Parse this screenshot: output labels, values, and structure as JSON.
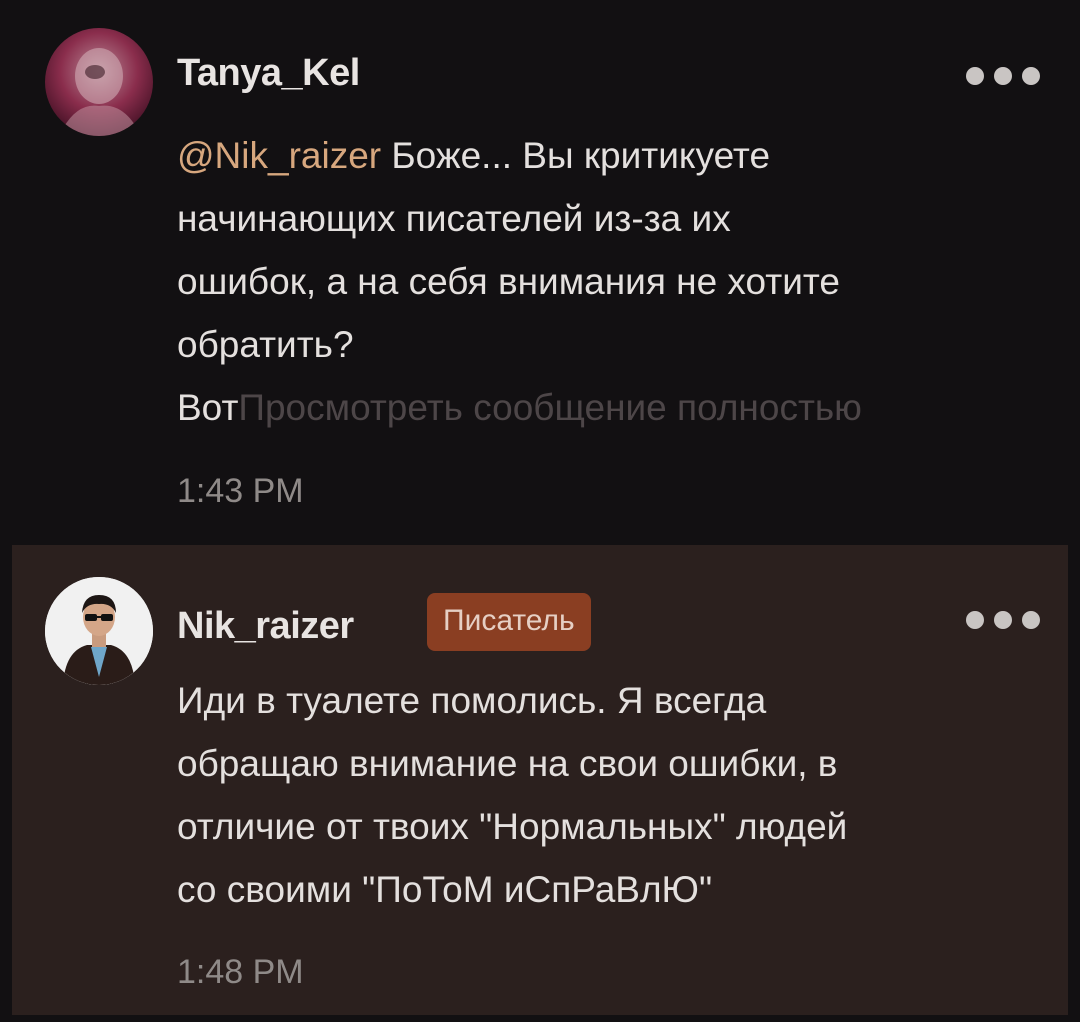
{
  "comments": [
    {
      "username": "Tanya_Kel",
      "avatar_icon": "user-avatar-photo-icon",
      "more_icon": "more-options-icon",
      "mention": "@Nik_raizer",
      "lines": [
        " Боже... Вы критикуете",
        "начинающих писателей из-за их",
        "ошибок, а на себя внимания не хотите",
        "обратить?"
      ],
      "last_line_visible": "Вот",
      "expand_link": "Просмотреть сообщение полностью",
      "time": "1:43 PM"
    },
    {
      "username": "Nik_raizer",
      "badge": "Писатель",
      "avatar_icon": "user-avatar-sunglasses-icon",
      "more_icon": "more-options-icon",
      "lines": [
        "Иди в туалете помолись. Я всегда",
        "обращаю внимание на свои ошибки, в",
        "отличие от твоих \"Нормальных\" людей",
        "со своими \"ПоТоМ иСпРаВлЮ\""
      ],
      "time": "1:48 PM"
    }
  ],
  "colors": {
    "background": "#121012",
    "highlight_background": "#2b201e",
    "mention": "#d7a77e",
    "badge": "#8a3e22",
    "text": "#e4e0de",
    "muted": "#8f8a88"
  }
}
